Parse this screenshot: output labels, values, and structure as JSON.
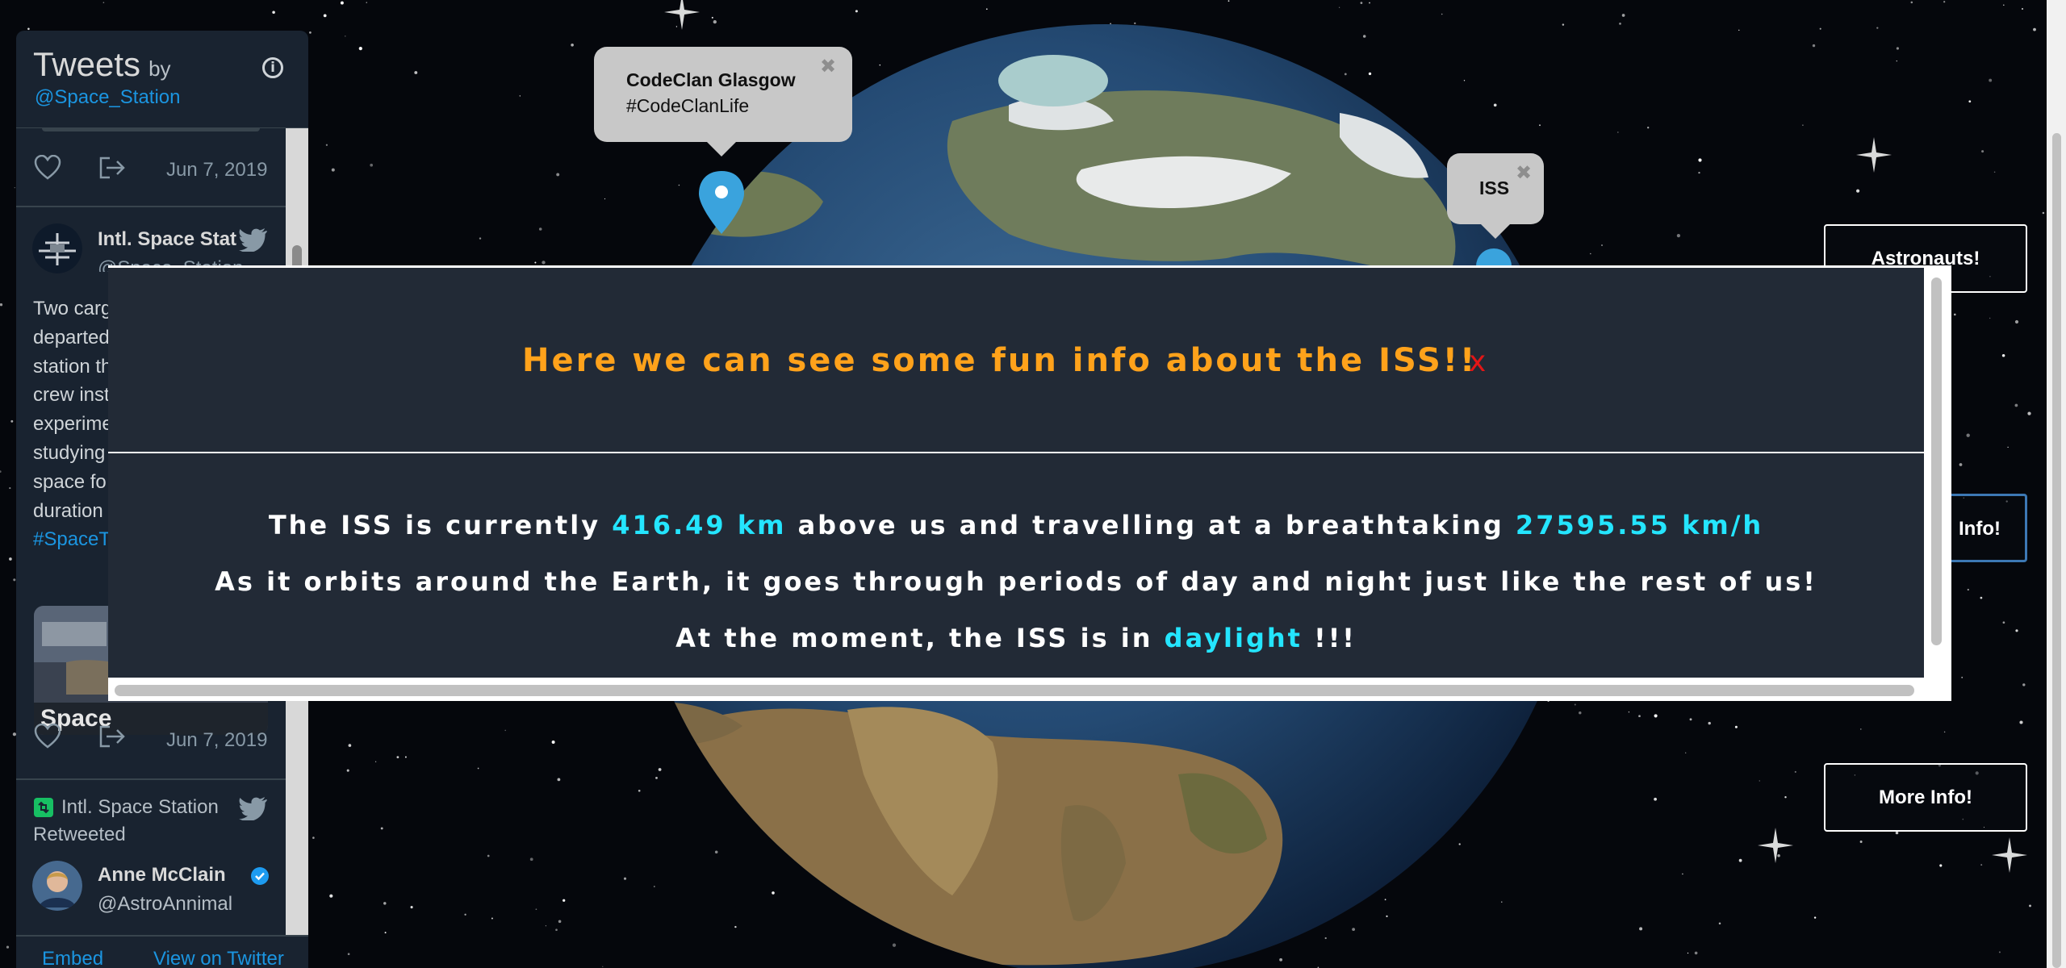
{
  "twitter": {
    "title": "Tweets",
    "by": "by",
    "handle": "@Space_Station",
    "tweet1_date": "Jun 7, 2019",
    "tweet2": {
      "name": "Intl. Space Stat",
      "handle": "@Space_Station",
      "lines": [
        "Two carg",
        "departed",
        "station th",
        "crew inst",
        "experime",
        "studying",
        "space fo",
        "duration"
      ],
      "hashtag": "#SpaceT",
      "media_caption": "Space",
      "date": "Jun 7, 2019"
    },
    "retweet": {
      "label": "Intl. Space Station",
      "label2": "Retweeted",
      "name": "Anne McClain",
      "handle": "@AstroAnnimal"
    },
    "footer": {
      "embed": "Embed",
      "view": "View on Twitter"
    }
  },
  "map": {
    "popup_codeclan": {
      "title": "CodeClan Glasgow",
      "subtitle": "#CodeClanLife",
      "close": "✖"
    },
    "popup_iss": {
      "title": "ISS",
      "close": "✖"
    }
  },
  "buttons": {
    "astronauts": "Astronauts!",
    "info": "Info!",
    "more_info": "More Info!"
  },
  "modal": {
    "title": "Here we can see some fun info about the ISS!!",
    "close": "x",
    "line1_pre": "The ISS is currently ",
    "altitude": "416.49 km",
    "line1_mid": " above us and travelling at a breathtaking ",
    "speed": "27595.55 km/h",
    "line2": "As it orbits around the Earth, it goes through periods of day and night just like the rest of us!",
    "line3_pre": "At the moment, the ISS is in ",
    "daylight": "daylight",
    "line3_post": " !!!"
  },
  "colors": {
    "modal_bg": "#222a36",
    "title": "#ffa21b",
    "highlight": "#24e5ff",
    "close": "#e31616",
    "twitter_link": "#1b95e0"
  }
}
